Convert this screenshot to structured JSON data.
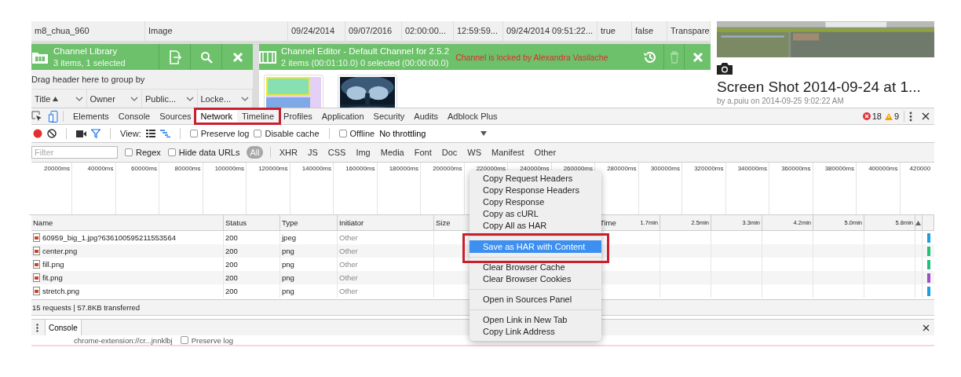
{
  "media_row": {
    "cells": [
      "m8_chua_960",
      "Image",
      "09/24/2014",
      "09/07/2016",
      "02:00:00...",
      "12:59:59...",
      "09/24/2014 09:51:22...",
      "true",
      "false",
      "Transpare"
    ]
  },
  "channel_library": {
    "title": "Channel Library",
    "subtitle": "3 items, 1 selected",
    "group_hint": "Drag header here to group by",
    "columns": [
      {
        "label": "Title",
        "sorted": true
      },
      {
        "label": "Owner",
        "sorted": false
      },
      {
        "label": "Public...",
        "sorted": false
      },
      {
        "label": "Locke...",
        "sorted": false
      }
    ]
  },
  "channel_editor": {
    "title": "Channel Editor - Default Channel for 2.5.2",
    "subtitle": "2 items (00:01:10.0) 0 selected (00:00:00.0)",
    "lock_message": "Channel is locked by Alexandra Vasilache",
    "items": [
      {
        "kind": "layout"
      },
      {
        "kind": "picture"
      }
    ]
  },
  "preview": {
    "kind": "picture",
    "title": "Screen Shot 2014-09-24 at 1...",
    "byline": "by a.puiu on 2014-09-25 9:02:22 AM"
  },
  "devtools": {
    "tabs": [
      {
        "label": "Elements",
        "selected": false
      },
      {
        "label": "Console",
        "selected": false
      },
      {
        "label": "Sources",
        "selected": false
      },
      {
        "label": "Network",
        "selected": true
      },
      {
        "label": "Timeline",
        "selected": false
      },
      {
        "label": "Profiles",
        "selected": false
      },
      {
        "label": "Application",
        "selected": false
      },
      {
        "label": "Security",
        "selected": false
      },
      {
        "label": "Audits",
        "selected": false
      },
      {
        "label": "Adblock Plus",
        "selected": false
      }
    ],
    "errors": "18",
    "warnings": "9",
    "toolbar": {
      "recording": true,
      "filter_active": true,
      "view_label": "View:",
      "view_buttons": [
        {
          "kind": "list",
          "selected": false
        },
        {
          "kind": "overview",
          "selected": true
        }
      ],
      "checkboxes": [
        {
          "label": "Preserve log",
          "checked": false
        },
        {
          "label": "Disable cache",
          "checked": false
        },
        {
          "label": "Offline",
          "checked": false
        }
      ],
      "throttling": "No throttling"
    },
    "filter": {
      "placeholder": "Filter",
      "checkboxes": [
        {
          "label": "Regex",
          "checked": false
        },
        {
          "label": "Hide data URLs",
          "checked": false
        }
      ],
      "types": [
        {
          "label": "All",
          "selected": true
        },
        {
          "label": "XHR",
          "selected": false
        },
        {
          "label": "JS",
          "selected": false
        },
        {
          "label": "CSS",
          "selected": false
        },
        {
          "label": "Img",
          "selected": false
        },
        {
          "label": "Media",
          "selected": false
        },
        {
          "label": "Font",
          "selected": false
        },
        {
          "label": "Doc",
          "selected": false
        },
        {
          "label": "WS",
          "selected": false
        },
        {
          "label": "Manifest",
          "selected": false
        },
        {
          "label": "Other",
          "selected": false
        }
      ]
    },
    "overview_ticks": [
      "20000ms",
      "40000ms",
      "60000ms",
      "80000ms",
      "100000ms",
      "120000ms",
      "140000ms",
      "160000ms",
      "180000ms",
      "200000ms",
      "220000ms",
      "240000ms",
      "260000ms",
      "280000ms",
      "300000ms",
      "320000ms",
      "340000ms",
      "360000ms",
      "380000ms",
      "400000ms",
      "420000"
    ],
    "table": {
      "columns": [
        "Name",
        "Status",
        "Type",
        "Initiator",
        "Size",
        "Time"
      ],
      "time_ticks": [
        "1.7min",
        "2.5min",
        "3.3min",
        "4.2min",
        "5.0min",
        "5.8min"
      ],
      "rows": [
        {
          "name": "60959_big_1.jpg?636100595211553564",
          "status": "200",
          "type": "jpeg",
          "initiator": "Other",
          "color": "#1a9fe0"
        },
        {
          "name": "center.png",
          "status": "200",
          "type": "png",
          "initiator": "Other",
          "color": "#20c07a"
        },
        {
          "name": "fill.png",
          "status": "200",
          "type": "png",
          "initiator": "Other",
          "color": "#20c07a"
        },
        {
          "name": "fit.png",
          "status": "200",
          "type": "png",
          "initiator": "Other",
          "color": "#9b4fc8"
        },
        {
          "name": "stretch.png",
          "status": "200",
          "type": "png",
          "initiator": "Other",
          "color": "#1a9fe0"
        }
      ]
    },
    "summary": "15 requests | 57.8KB transferred",
    "drawer": {
      "tabs": [
        {
          "label": "Console",
          "selected": true
        }
      ],
      "context": "chrome-extension://cr...jnnklbj",
      "checkbox": {
        "label": "Preserve log",
        "checked": false
      }
    }
  },
  "context_menu": {
    "groups": [
      [
        {
          "label": "Copy Request Headers",
          "selected": false
        },
        {
          "label": "Copy Response Headers",
          "selected": false
        },
        {
          "label": "Copy Response",
          "selected": false
        },
        {
          "label": "Copy as cURL",
          "selected": false
        },
        {
          "label": "Copy All as HAR",
          "selected": false
        }
      ],
      [
        {
          "label": "Save as HAR with Content",
          "selected": true
        }
      ],
      [
        {
          "label": "Clear Browser Cache",
          "selected": false
        },
        {
          "label": "Clear Browser Cookies",
          "selected": false
        }
      ],
      [
        {
          "label": "Open in Sources Panel",
          "selected": false
        }
      ],
      [
        {
          "label": "Open Link in New Tab",
          "selected": false
        },
        {
          "label": "Copy Link Address",
          "selected": false
        }
      ]
    ]
  }
}
